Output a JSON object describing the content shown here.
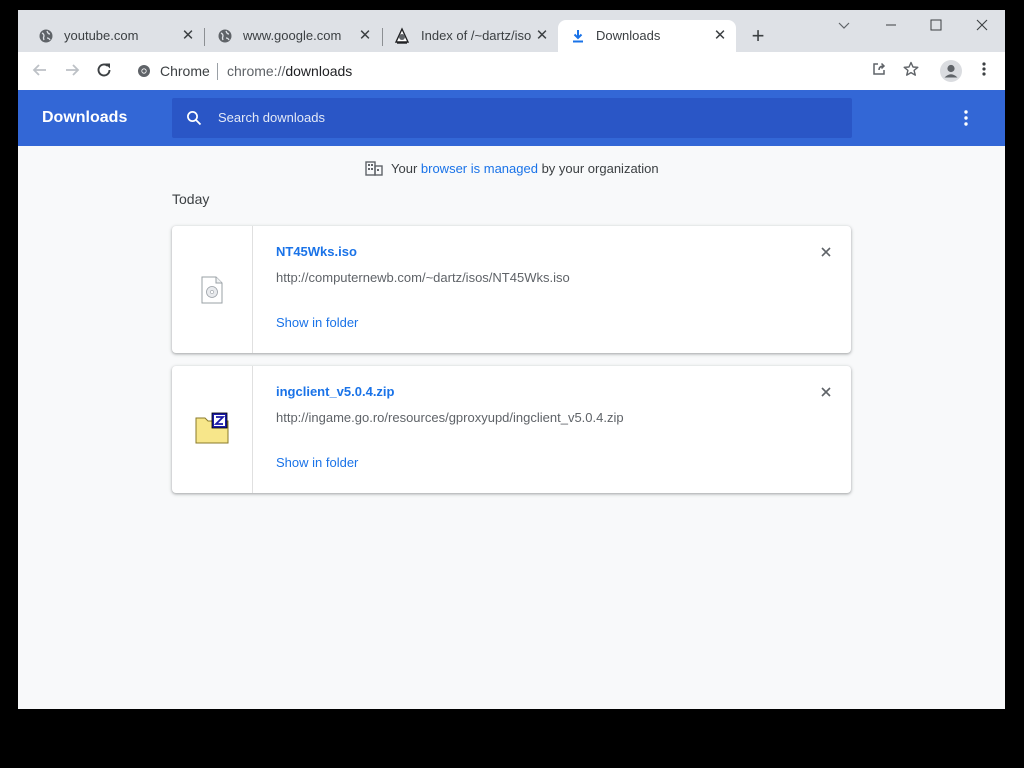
{
  "tabs": [
    {
      "title": "youtube.com",
      "icon": "globe-icon"
    },
    {
      "title": "www.google.com",
      "icon": "globe-icon"
    },
    {
      "title": "Index of /~dartz/isos",
      "icon": "directory-icon"
    },
    {
      "title": "Downloads",
      "icon": "download-icon",
      "active": true
    }
  ],
  "toolbar": {
    "site_label": "Chrome",
    "url_scheme": "chrome://",
    "url_host": "downloads"
  },
  "downloads_page": {
    "title": "Downloads",
    "search_placeholder": "Search downloads",
    "managed_prefix": "Your ",
    "managed_link": "browser is managed",
    "managed_suffix": " by your organization",
    "section_label": "Today",
    "items": [
      {
        "filename": "NT45Wks.iso",
        "url": "http://computernewb.com/~dartz/isos/NT45Wks.iso",
        "action": "Show in folder",
        "file_icon": "disc-image-file-icon"
      },
      {
        "filename": "ingclient_v5.0.4.zip",
        "url": "http://ingame.go.ro/resources/gproxyupd/ingclient_v5.0.4.zip",
        "action": "Show in folder",
        "file_icon": "zip-archive-file-icon"
      }
    ]
  },
  "colors": {
    "header_blue": "#3367d6",
    "search_blue": "#2a56c6",
    "link_blue": "#1a73e8"
  }
}
